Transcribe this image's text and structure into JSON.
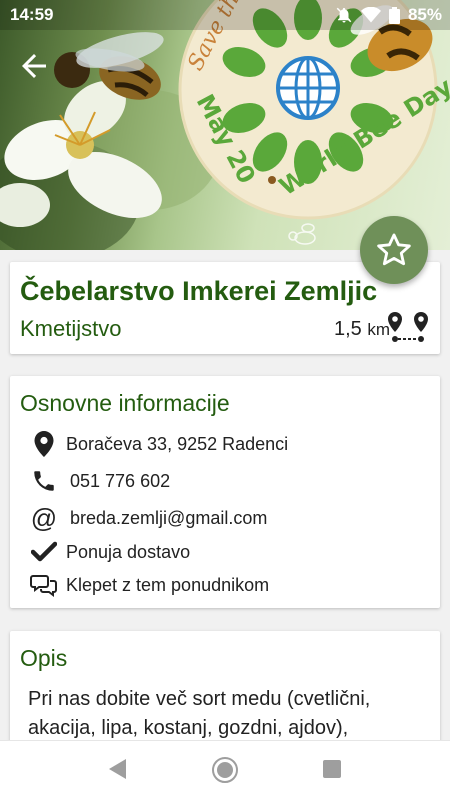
{
  "status_bar": {
    "time": "14:59",
    "battery": "85%"
  },
  "hero": {
    "badge_top": "Save th",
    "badge_date": "May 20",
    "badge_event": "World Bee Day"
  },
  "listing": {
    "title": "Čebelarstvo Imkerei Zemljic",
    "category": "Kmetijstvo",
    "distance_value": "1,5",
    "distance_unit": "km"
  },
  "info": {
    "heading": "Osnovne informacije",
    "address": "Boračeva 33, 9252 Radenci",
    "phone": "051 776 602",
    "email": "breda.zemlji@gmail.com",
    "delivery": "Ponuja dostavo",
    "chat": "Klepet z tem ponudnikom"
  },
  "description": {
    "heading": "Opis",
    "text": "Pri nas dobite več sort medu (cvetlični, akacija, lipa, kostanj, gozdni, ajdov),"
  },
  "icons": {
    "back": "arrow-left-icon",
    "favorite": "star-icon",
    "route": "route-pins-icon",
    "address": "map-pin-icon",
    "phone": "phone-icon",
    "email": "at-icon",
    "delivery": "checkmark-icon",
    "chat": "chat-bubbles-icon"
  },
  "colors": {
    "accent_green": "#245c10",
    "fab": "#6f9059"
  }
}
